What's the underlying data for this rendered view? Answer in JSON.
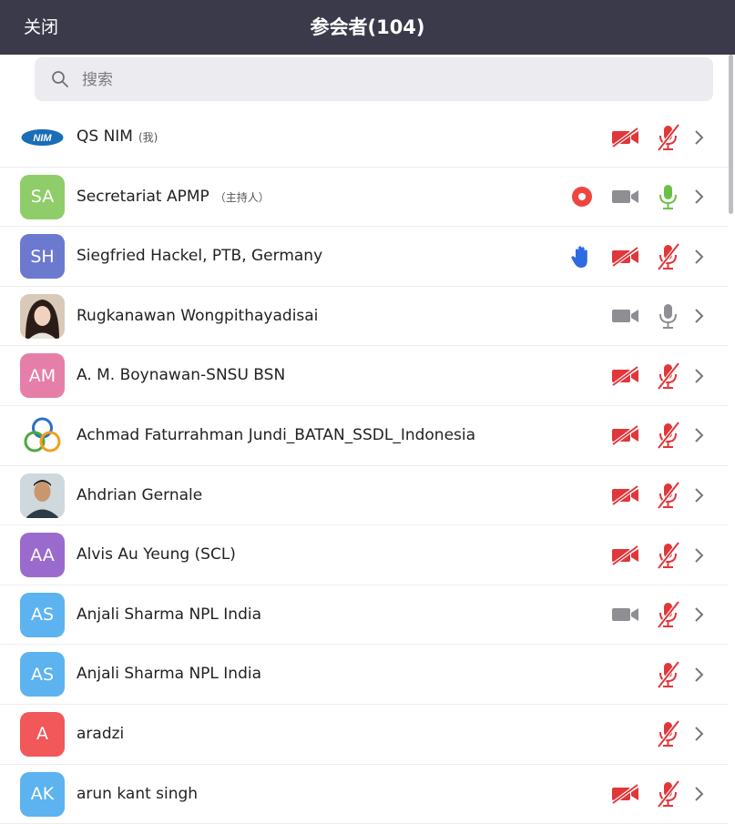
{
  "header": {
    "close_label": "关闭",
    "title": "参会者(104)"
  },
  "search": {
    "placeholder": "搜索"
  },
  "colors": {
    "header_bg": "#3a3a4a",
    "muted_red": "#e0373b",
    "unmuted_green": "#6cc04a",
    "neutral_gray": "#8e8e93",
    "hand_blue": "#2d6be0"
  },
  "participants": [
    {
      "name": "QS NIM",
      "tag": "(我)",
      "avatar_text": "",
      "avatar_kind": "logo-nim",
      "record": false,
      "hand": false,
      "video": "off",
      "mic": "muted"
    },
    {
      "name": "Secretariat APMP",
      "tag": "（主持人）",
      "avatar_text": "SA",
      "avatar_color": "#8fcd6a",
      "record": true,
      "hand": false,
      "video": "idle",
      "mic": "on"
    },
    {
      "name": "Siegfried Hackel, PTB, Germany",
      "tag": "",
      "avatar_text": "SH",
      "avatar_color": "#6b79cf",
      "record": false,
      "hand": true,
      "video": "off",
      "mic": "muted"
    },
    {
      "name": "Rugkanawan Wongpithayadisai",
      "tag": "",
      "avatar_text": "",
      "avatar_kind": "photo-woman",
      "record": false,
      "hand": false,
      "video": "idle",
      "mic": "idle"
    },
    {
      "name": "A. M. Boynawan-SNSU BSN",
      "tag": "",
      "avatar_text": "AM",
      "avatar_color": "#e57fa9",
      "record": false,
      "hand": false,
      "video": "off",
      "mic": "muted"
    },
    {
      "name": "Achmad Faturrahman Jundi_BATAN_SSDL_Indonesia",
      "tag": "",
      "avatar_text": "",
      "avatar_kind": "logo-knot",
      "record": false,
      "hand": false,
      "video": "off",
      "mic": "muted"
    },
    {
      "name": "Ahdrian Gernale",
      "tag": "",
      "avatar_text": "",
      "avatar_kind": "photo-man",
      "record": false,
      "hand": false,
      "video": "off",
      "mic": "muted"
    },
    {
      "name": "Alvis Au Yeung (SCL)",
      "tag": "",
      "avatar_text": "AA",
      "avatar_color": "#9a6bcc",
      "record": false,
      "hand": false,
      "video": "off",
      "mic": "muted"
    },
    {
      "name": "Anjali Sharma NPL India",
      "tag": "",
      "avatar_text": "AS",
      "avatar_color": "#5cb3f0",
      "record": false,
      "hand": false,
      "video": "idle",
      "mic": "muted"
    },
    {
      "name": "Anjali Sharma NPL India",
      "tag": "",
      "avatar_text": "AS",
      "avatar_color": "#5cb3f0",
      "record": false,
      "hand": false,
      "video": "none",
      "mic": "muted"
    },
    {
      "name": "aradzi",
      "tag": "",
      "avatar_text": "A",
      "avatar_color": "#f2575a",
      "record": false,
      "hand": false,
      "video": "none",
      "mic": "muted"
    },
    {
      "name": "arun kant singh",
      "tag": "",
      "avatar_text": "AK",
      "avatar_color": "#5cb3f0",
      "record": false,
      "hand": false,
      "video": "off",
      "mic": "muted"
    }
  ]
}
